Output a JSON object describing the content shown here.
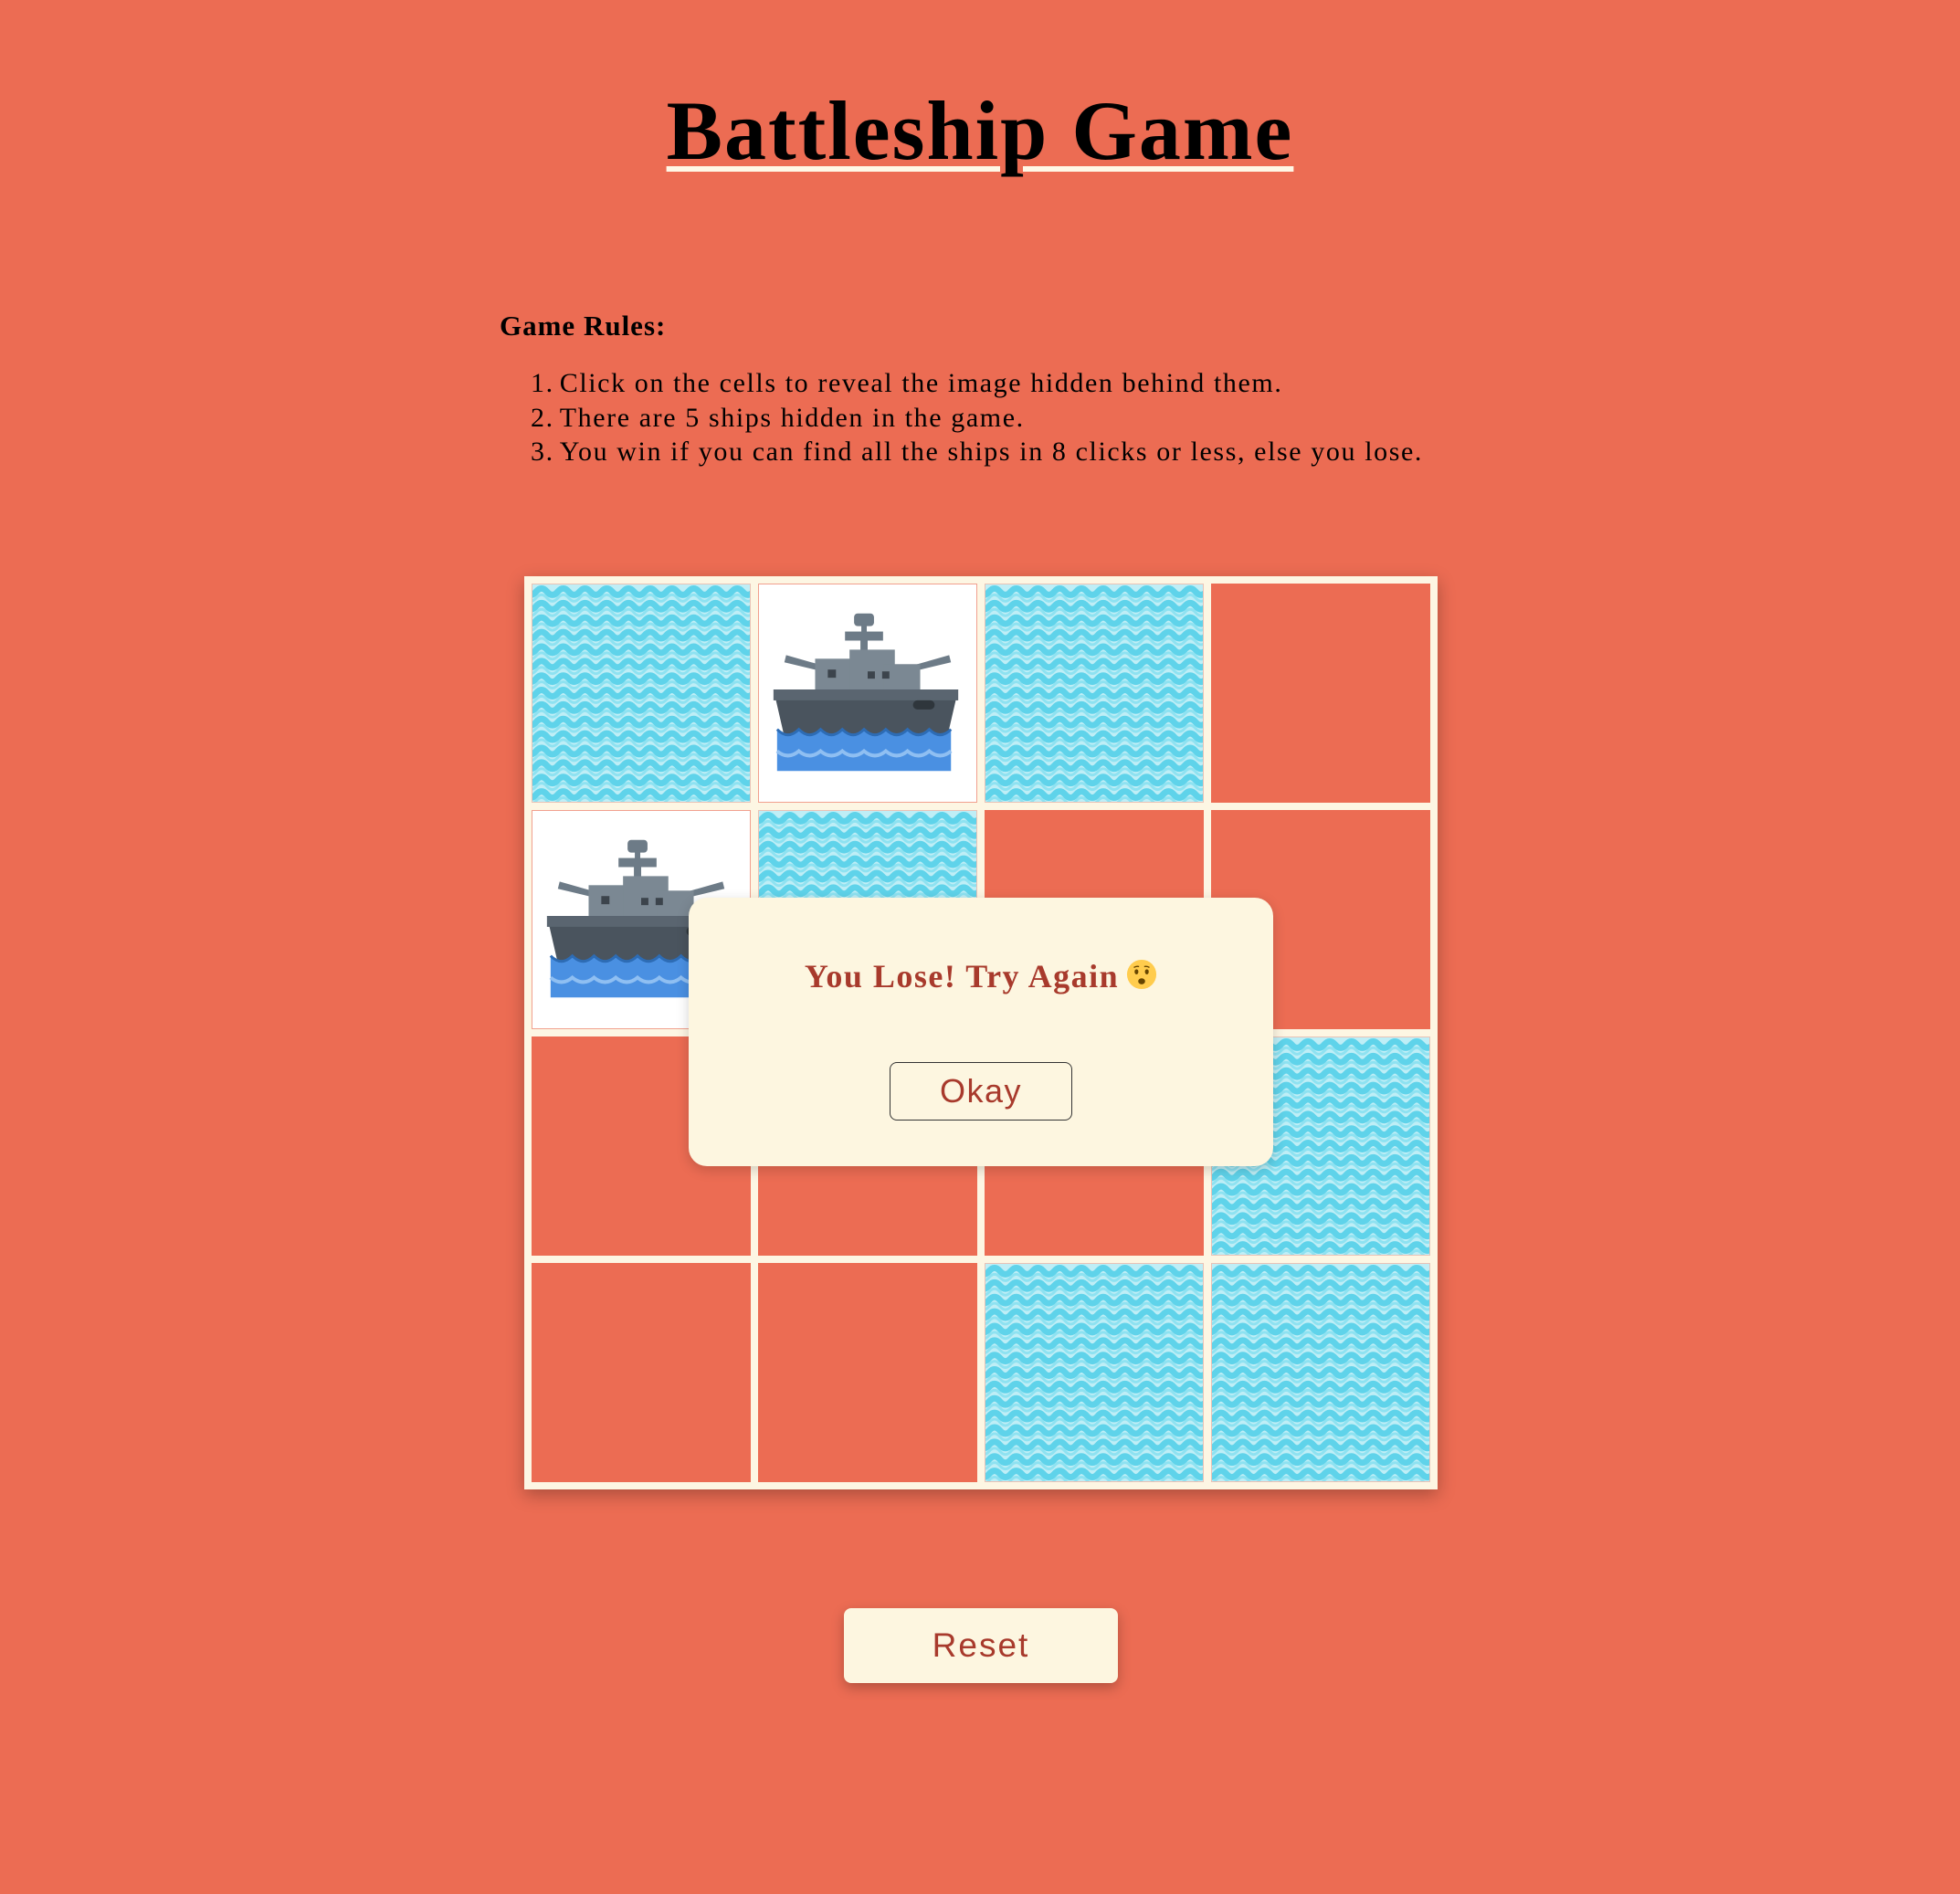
{
  "title": "Battleship Game",
  "rules": {
    "heading": "Game Rules:",
    "items": [
      {
        "num": "1.",
        "text": "Click on the cells to reveal the image hidden behind them."
      },
      {
        "num": "2.",
        "text": "There are 5 ships hidden in the game."
      },
      {
        "num": "3.",
        "text": "You win if you can find all the ships in 8 clicks or less, else you lose."
      }
    ]
  },
  "board": {
    "rows": 4,
    "cols": 4,
    "cells": [
      "water",
      "ship",
      "water",
      "hidden",
      "ship",
      "water",
      "hidden",
      "hidden",
      "hidden",
      "hidden",
      "hidden",
      "water",
      "hidden",
      "hidden",
      "water",
      "water"
    ],
    "colors": {
      "background": "#ec6c53",
      "grid": "#fdf6e3",
      "water_light": "#bfeef6",
      "water_wave": "#5fd3ea",
      "ship_hull": "#4a545e",
      "ship_deck": "#6d7b87",
      "sea": "#4a90e2"
    }
  },
  "modal": {
    "message": "You Lose! Try Again",
    "emoji_icon": "worried-face-icon",
    "okay_label": "Okay"
  },
  "reset_label": "Reset",
  "colors": {
    "page_background": "#ec6c53",
    "panel": "#fdf6e0",
    "accent_text": "#a83a2c"
  }
}
